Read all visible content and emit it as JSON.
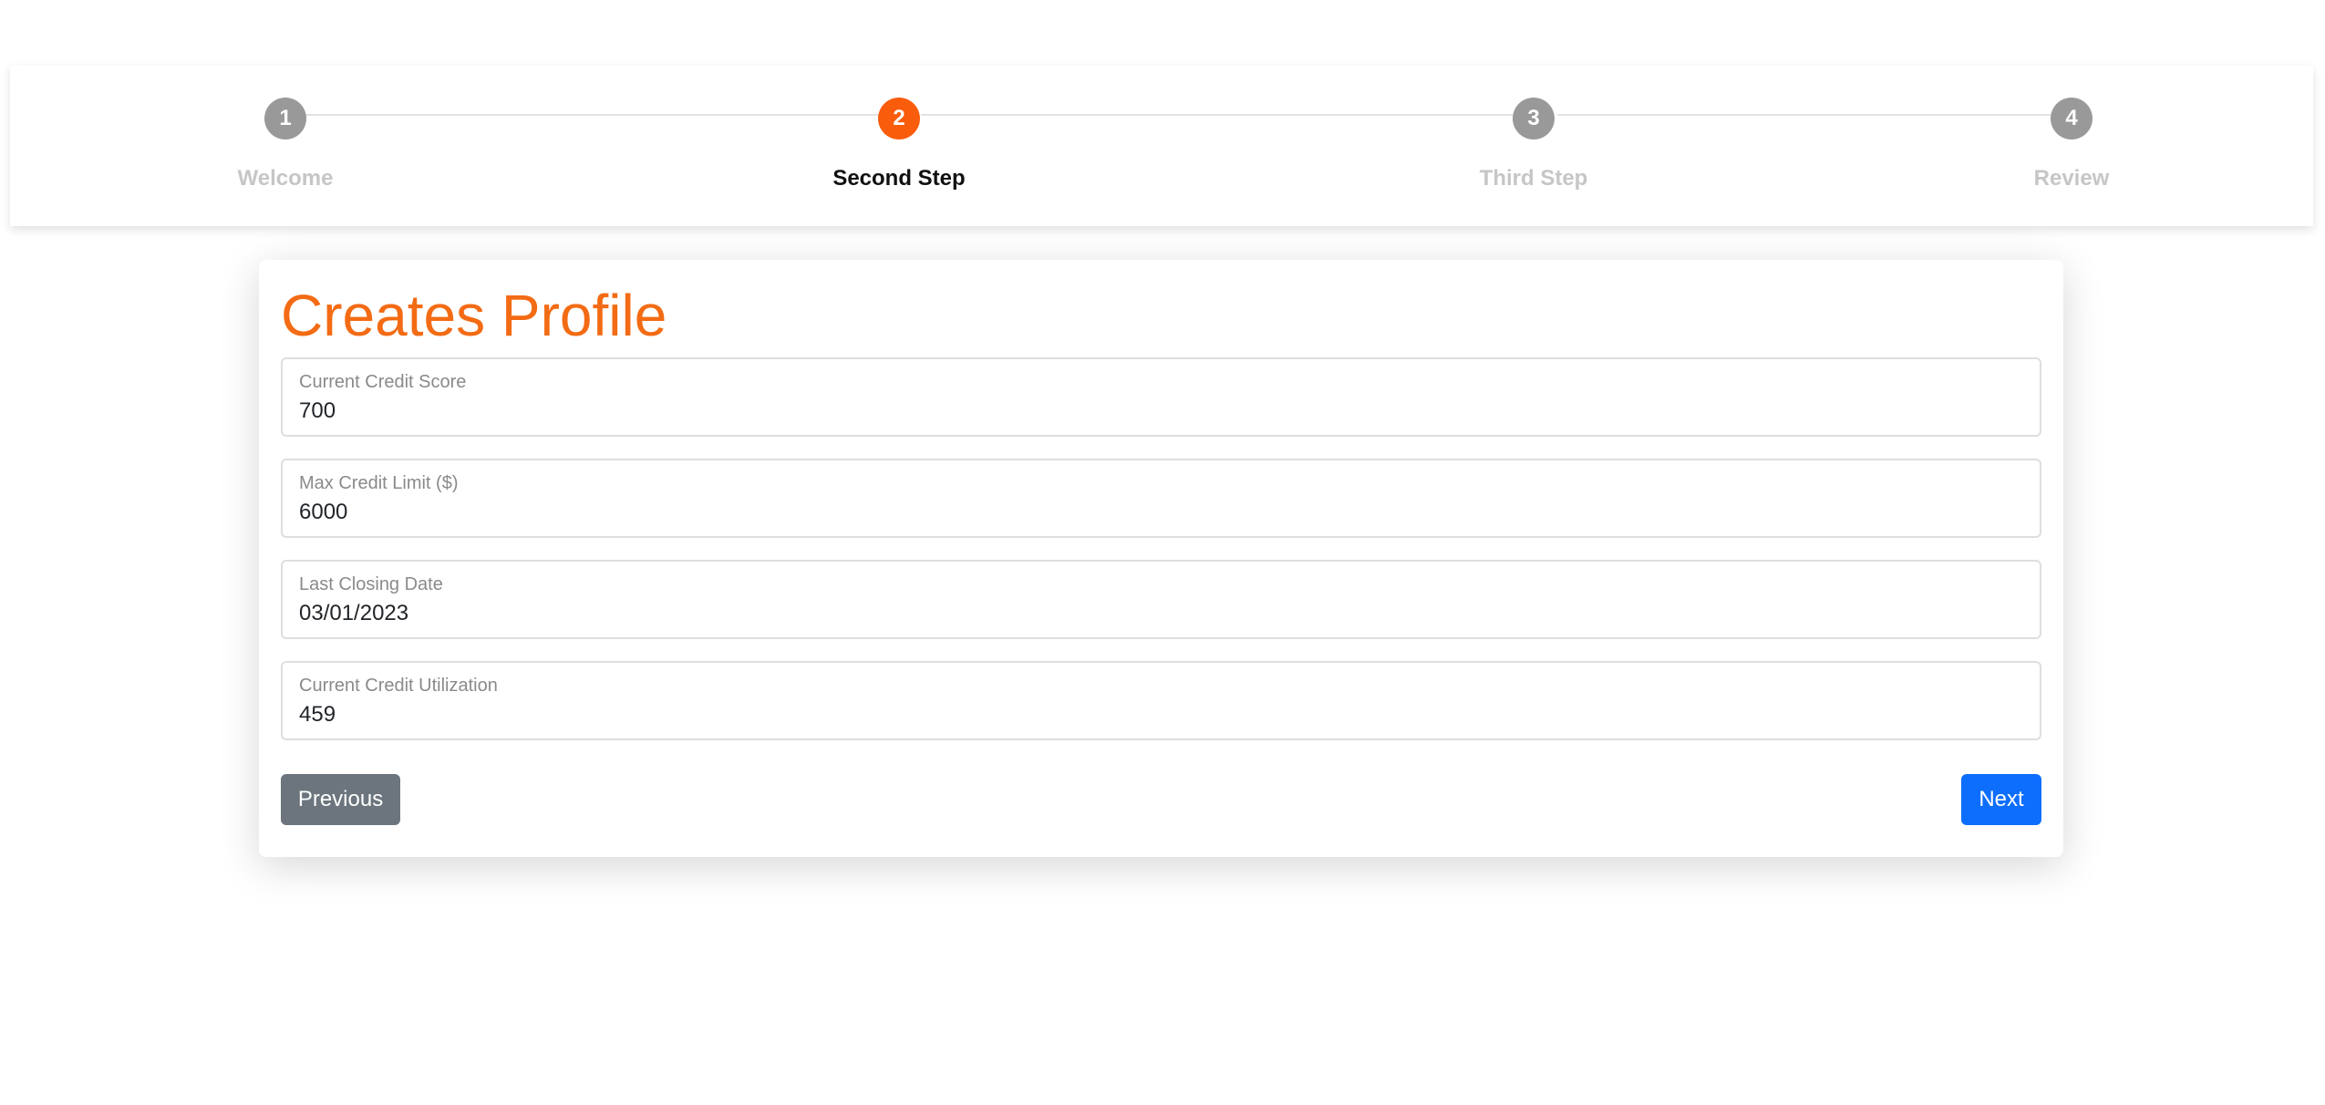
{
  "stepper": {
    "steps": [
      {
        "number": "1",
        "label": "Welcome",
        "active": false
      },
      {
        "number": "2",
        "label": "Second Step",
        "active": true
      },
      {
        "number": "3",
        "label": "Third Step",
        "active": false
      },
      {
        "number": "4",
        "label": "Review",
        "active": false
      }
    ],
    "colors": {
      "active": "#f95c0b",
      "inactive": "#999999"
    }
  },
  "form": {
    "title": "Creates Profile",
    "fields": [
      {
        "label": "Current Credit Score",
        "value": "700"
      },
      {
        "label": "Max Credit Limit ($)",
        "value": "6000"
      },
      {
        "label": "Last Closing Date",
        "value": "03/01/2023"
      },
      {
        "label": "Current Credit Utilization",
        "value": "459"
      }
    ],
    "previous_label": "Previous",
    "next_label": "Next",
    "colors": {
      "title": "#f36b14",
      "previous": "#6c757d",
      "next": "#0d6efd"
    }
  }
}
